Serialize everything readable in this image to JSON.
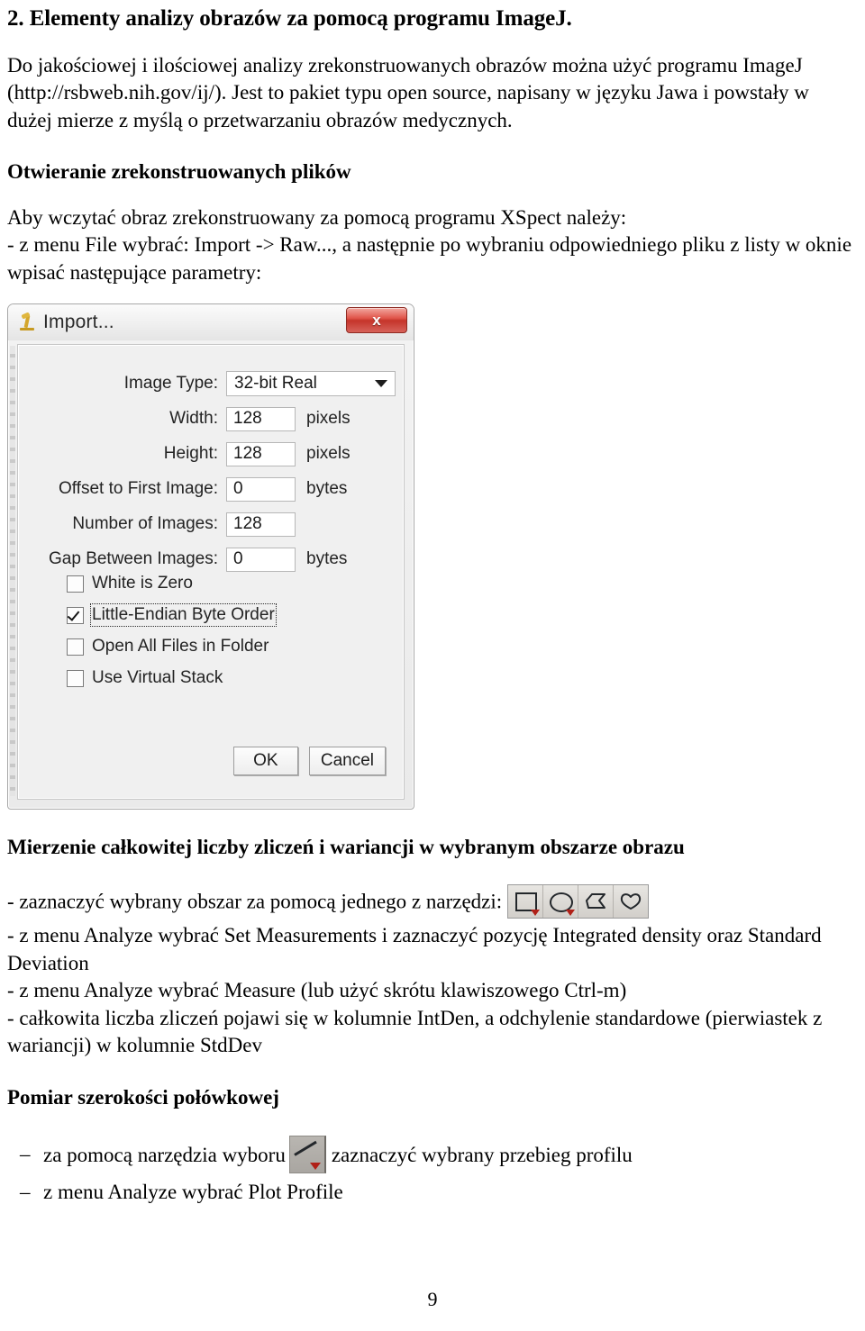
{
  "document": {
    "heading": "2. Elementy analizy obrazów za pomocą programu ImageJ.",
    "intro": "Do jakościowej i ilościowej analizy zrekonstruowanych obrazów można użyć programu ImageJ (http://rsbweb.nih.gov/ij/). Jest to pakiet typu open source, napisany w języku Jawa i powstały w dużej mierze z myślą o przetwarzaniu obrazów medycznych.",
    "page_number": "9"
  },
  "section_open_files": {
    "heading": "Otwieranie zrekonstruowanych plików",
    "line1": "Aby wczytać obraz zrekonstruowany za pomocą programu XSpect należy:",
    "line2": "- z menu File wybrać: Import -> Raw...,  a następnie po wybraniu odpowiedniego pliku z listy  w oknie wpisać następujące parametry:"
  },
  "import_dialog": {
    "title": "Import...",
    "close_label": "x",
    "fields": [
      {
        "label": "Image Type:",
        "value": "32-bit Real",
        "unit": "",
        "control": "combo"
      },
      {
        "label": "Width:",
        "value": "128",
        "unit": "pixels",
        "control": "input"
      },
      {
        "label": "Height:",
        "value": "128",
        "unit": "pixels",
        "control": "input"
      },
      {
        "label": "Offset to First Image:",
        "value": "0",
        "unit": "bytes",
        "control": "input"
      },
      {
        "label": "Number of Images:",
        "value": "128",
        "unit": "",
        "control": "input"
      },
      {
        "label": "Gap Between Images:",
        "value": "0",
        "unit": "bytes",
        "control": "input"
      }
    ],
    "checkboxes": [
      {
        "label": "White is Zero",
        "checked": false,
        "focused": false
      },
      {
        "label": "Little-Endian Byte Order",
        "checked": true,
        "focused": true
      },
      {
        "label": "Open All Files in Folder",
        "checked": false,
        "focused": false
      },
      {
        "label": "Use Virtual Stack",
        "checked": false,
        "focused": false
      }
    ],
    "ok_label": "OK",
    "cancel_label": "Cancel"
  },
  "section_measure": {
    "heading": "Mierzenie całkowitej liczby zliczeń i wariancji w wybranym obszarze obrazu",
    "line_tools_prefix": "- zaznaczyć wybrany obszar za pomocą jednego z narzędzi:",
    "tools": [
      {
        "name": "rectangle-selection-tool",
        "has_dropdown": true
      },
      {
        "name": "oval-selection-tool",
        "has_dropdown": true
      },
      {
        "name": "polygon-selection-tool",
        "has_dropdown": false
      },
      {
        "name": "freehand-selection-tool",
        "has_dropdown": false
      }
    ],
    "line2": "- z menu Analyze wybrać Set Measurements i zaznaczyć pozycję Integrated density oraz Standard Deviation",
    "line3": "- z menu Analyze wybrać Measure (lub użyć skrótu klawiszowego Ctrl-m)",
    "line4": "- całkowita liczba zliczeń pojawi się w kolumnie IntDen, a odchylenie standardowe (pierwiastek z wariancji) w kolumnie StdDev"
  },
  "section_fwhm": {
    "heading": "Pomiar szerokości połówkowej",
    "bullet1_prefix": "za pomocą narzędzia wyboru",
    "bullet1_suffix": "zaznaczyć wybrany przebieg profilu",
    "bullet2": "z menu Analyze wybrać Plot Profile",
    "dash": "–",
    "line_tool_name": "line-selection-tool"
  }
}
